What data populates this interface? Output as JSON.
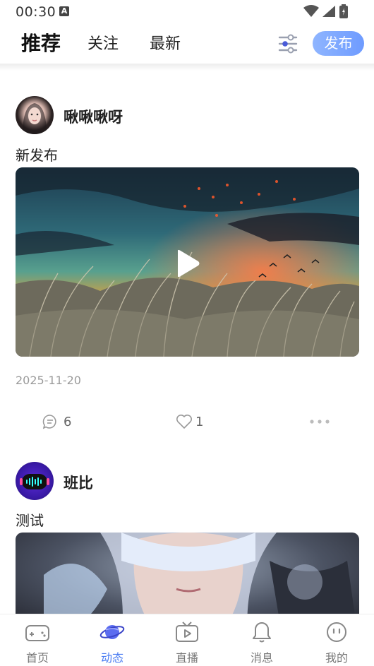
{
  "status_bar": {
    "time": "00:30",
    "notification_letter": "A"
  },
  "top_nav": {
    "tabs": [
      {
        "label": "推荐",
        "active": true
      },
      {
        "label": "关注",
        "active": false
      },
      {
        "label": "最新",
        "active": false
      }
    ],
    "publish_label": "发布"
  },
  "posts": [
    {
      "author": "啾啾啾呀",
      "text": "新发布",
      "media_type": "video",
      "date": "2025-11-20",
      "comments": "6",
      "likes": "1"
    },
    {
      "author": "班比",
      "text": "测试",
      "media_type": "image"
    }
  ],
  "bottom_nav": {
    "items": [
      {
        "label": "首页",
        "icon": "gamepad-icon"
      },
      {
        "label": "动态",
        "icon": "planet-icon",
        "active": true
      },
      {
        "label": "直播",
        "icon": "tv-play-icon"
      },
      {
        "label": "消息",
        "icon": "bell-icon"
      },
      {
        "label": "我的",
        "icon": "face-icon"
      }
    ]
  },
  "colors": {
    "accent": "#4a7cf2",
    "publish_gradient_start": "#8fb5ff",
    "publish_gradient_end": "#6e9bff"
  }
}
